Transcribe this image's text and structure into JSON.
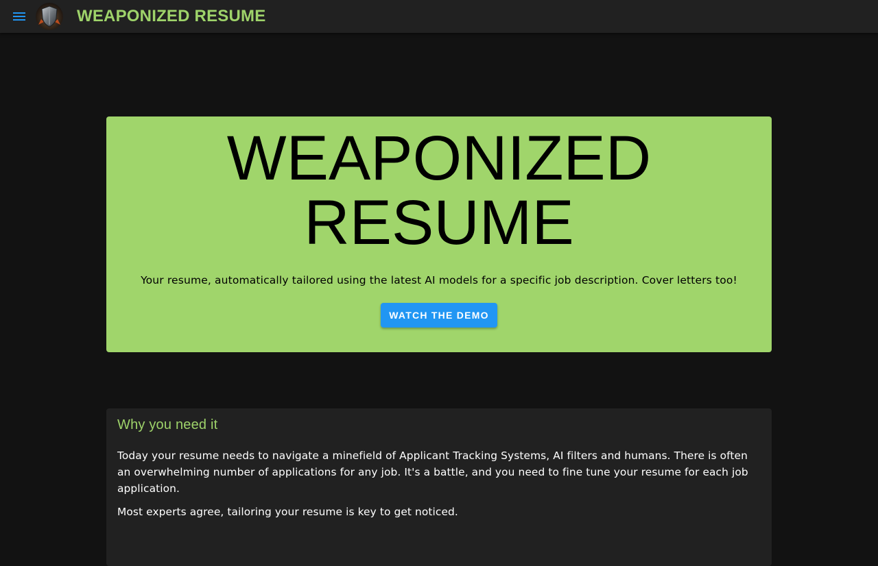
{
  "header": {
    "title": "WEAPONIZED RESUME",
    "accent_color": "#9ed36a",
    "menu_icon": "hamburger-menu-icon",
    "logo_icon": "shield-logo-icon"
  },
  "hero": {
    "title_line1": "WEAPONIZED",
    "title_line2": "RESUME",
    "subtitle": "Your resume, automatically tailored using the latest AI models for a specific job description. Cover letters too!",
    "button_label": "WATCH THE DEMO",
    "background_color": "#a0d56b",
    "button_color": "#2196f3"
  },
  "why": {
    "title": "Why you need it",
    "paragraphs": [
      "Today your resume needs to navigate a minefield of Applicant Tracking Systems, AI filters and humans. There is often an overwhelming number of applications for any job. It's a battle, and you need to fine tune your resume for each job application.",
      "Most experts agree, tailoring your resume is key to get noticed."
    ]
  }
}
